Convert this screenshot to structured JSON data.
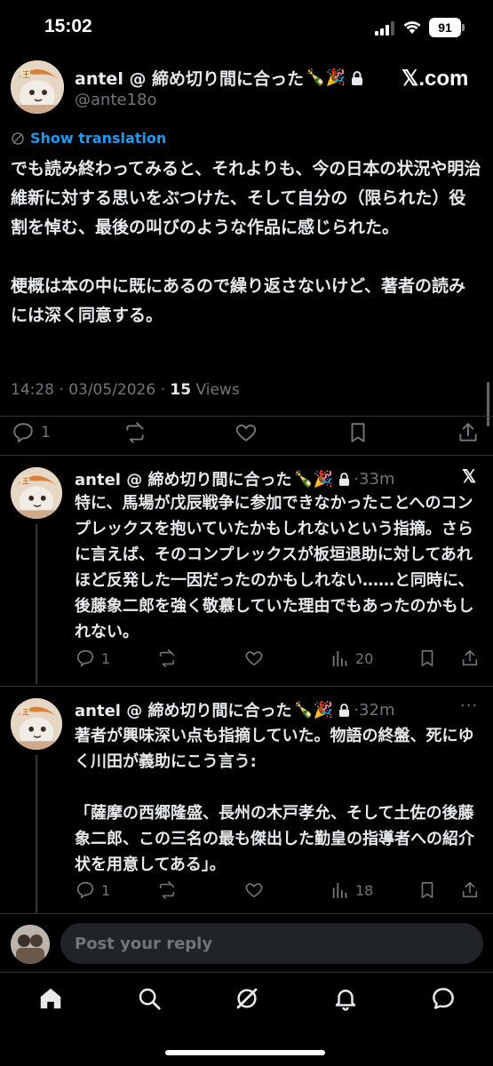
{
  "status_bar": {
    "time": "15:02",
    "battery": "91"
  },
  "main_tweet": {
    "display_name": "antel @ 締め切り間に合った",
    "emoji": "🍾🎉",
    "handle": "@ante18o",
    "x_label": "𝕏.com",
    "translate_label": "Show translation",
    "text": "でも読み終わってみると、それよりも、今の日本の状況や明治維新に対する思いをぶつけた、そして自分の（限られた）役割を悼む、最後の叫びのような作品に感じられた。\n\n梗概は本の中に既にあるので繰り返さないけど、著者の読みには深く同意する。",
    "meta": "14:28 · 03/05/2026 · ",
    "views_count": "15",
    "views_label": " Views",
    "replies": "1"
  },
  "replies": [
    {
      "display_name": "antel @ 締め切り間に合った",
      "emoji": "🍾🎉",
      "time": "·33m",
      "text": "特に、馬場が戊辰戦争に参加できなかったことへのコンプレックスを抱いていたかもしれないという指摘。さらに言えば、そのコンプレックスが板垣退助に対してあれほど反発した一因だったのかもしれない……と同時に、後藤象二郎を強く敬慕していた理由でもあったのかもしれない。",
      "reply_count": "1",
      "views": "20"
    },
    {
      "display_name": "antel @ 締め切り間に合った",
      "emoji": "🍾🎉",
      "time": "·32m",
      "text": "著者が興味深い点も指摘していた。物語の終盤、死にゆく川田が義助にこう言う:\n\n「薩摩の西郷隆盛、長州の木戸孝允、そして土佐の後藤象二郎、この三名の最も傑出した勤皇の指導者への紹介状を用意してある」。",
      "reply_count": "1",
      "views": "18"
    }
  ],
  "compose": {
    "placeholder": "Post your reply"
  },
  "icons": {
    "home": "home-icon",
    "search": "search-icon",
    "grok": "grok-icon",
    "notifications": "bell-icon",
    "messages": "message-icon"
  },
  "colors": {
    "accent": "#1d9bf0",
    "muted": "#71767b",
    "background": "#000000",
    "text": "#e7e9ea"
  }
}
